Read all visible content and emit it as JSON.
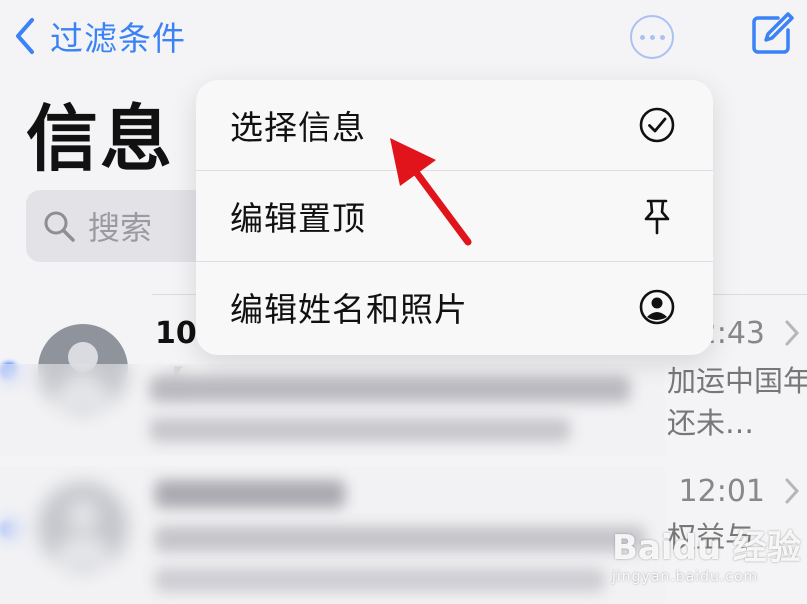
{
  "header": {
    "back_label": "过滤条件",
    "title": "信息"
  },
  "search": {
    "placeholder": "搜索"
  },
  "context_menu": {
    "items": [
      {
        "label": "选择信息",
        "icon": "checkmark-circle-icon"
      },
      {
        "label": "编辑置顶",
        "icon": "pin-icon"
      },
      {
        "label": "编辑姓名和照片",
        "icon": "person-circle-icon"
      }
    ]
  },
  "conversations": [
    {
      "sender": "10",
      "time": "2:43",
      "preview_line1": "【",
      "preview_line1_end": "加运中国年】",
      "preview_line2_end": "还未…"
    },
    {
      "sender": "",
      "time": "12:01",
      "preview_line1_end": "权益与",
      "preview_line2_end": ""
    }
  ],
  "watermark": {
    "brand": "Baidu 经验",
    "url": "jingyan.baidu.com"
  },
  "colors": {
    "accent": "#3b82f6",
    "arrow": "#e1141b"
  }
}
